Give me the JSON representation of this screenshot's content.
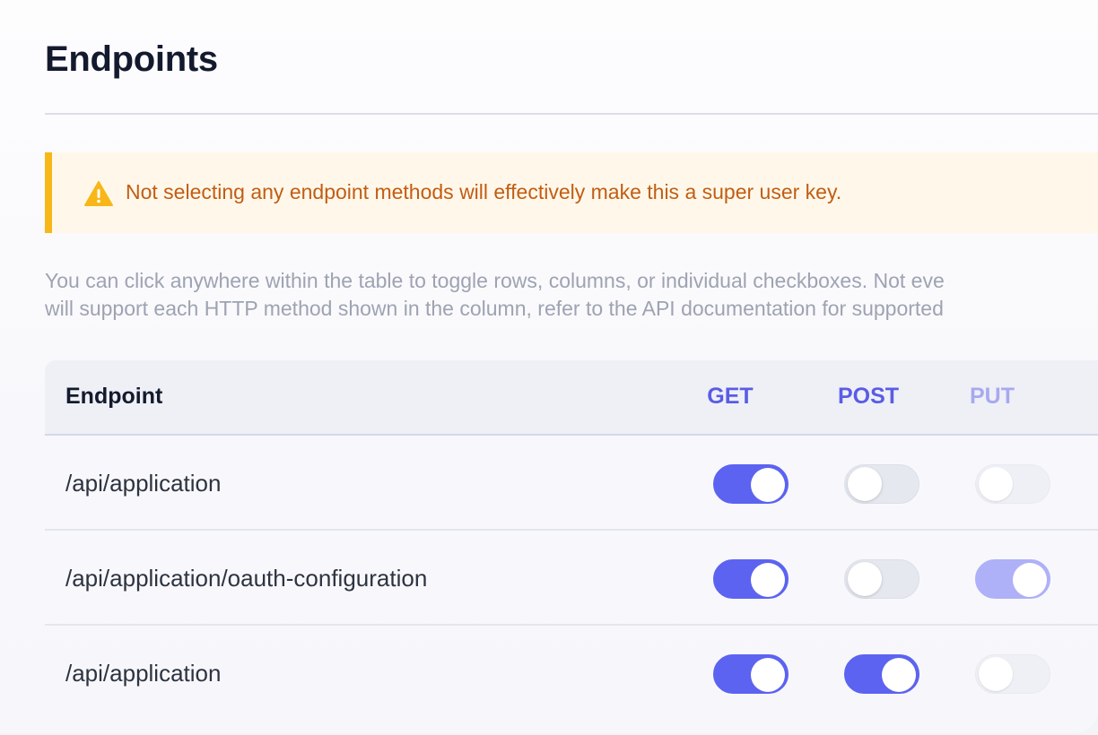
{
  "page": {
    "title": "Endpoints"
  },
  "warning": {
    "icon": "warning-icon",
    "text": "Not selecting any endpoint methods will effectively make this a super user key.",
    "accent_color": "#f7b718",
    "text_color": "#c25d14"
  },
  "help": {
    "line1": "You can click anywhere within the table to toggle rows, columns, or individual checkboxes. Not eve",
    "line2": "will support each HTTP method shown in the column, refer to the API documentation for supported"
  },
  "table": {
    "headers": {
      "endpoint": "Endpoint",
      "get": "GET",
      "post": "POST",
      "put": "PUT"
    },
    "rows": [
      {
        "path": "/api/application",
        "get": true,
        "post": false,
        "put": false
      },
      {
        "path": "/api/application/oauth-configuration",
        "get": true,
        "post": false,
        "put": true
      },
      {
        "path": "/api/application",
        "get": true,
        "post": true,
        "put": false
      }
    ]
  },
  "colors": {
    "toggle_on": "#5c63f0",
    "toggle_off": "#e6e8ef",
    "method_header": "#5a5ce6"
  }
}
